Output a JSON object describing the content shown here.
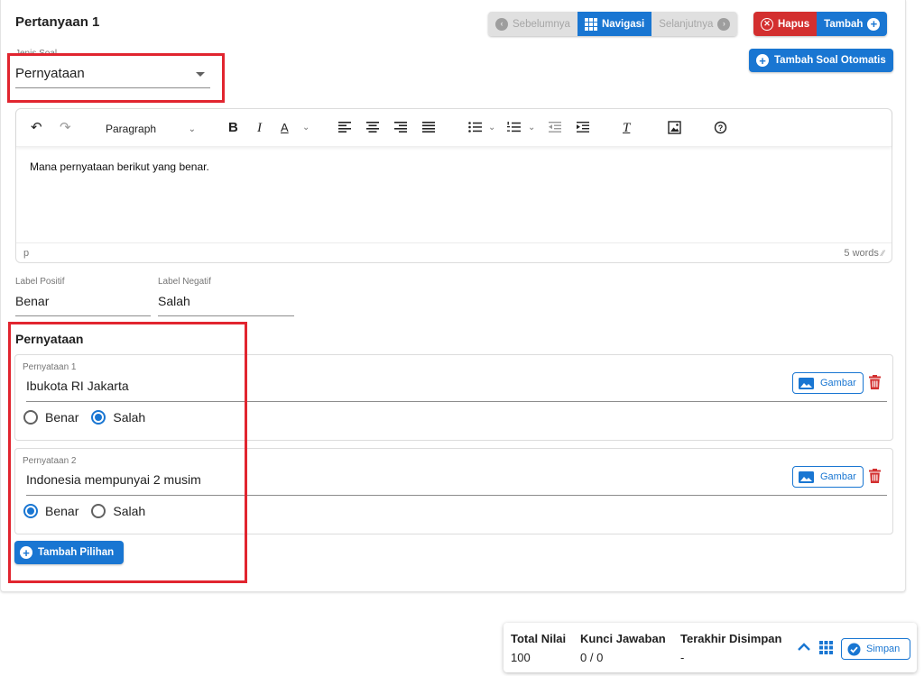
{
  "question": {
    "title": "Pertanyaan 1"
  },
  "nav": {
    "prev": "Sebelumnya",
    "navigate": "Navigasi",
    "next": "Selanjutnya"
  },
  "actions": {
    "delete": "Hapus",
    "add": "Tambah",
    "auto_add": "Tambah Soal Otomatis"
  },
  "question_type": {
    "label": "Jenis Soal",
    "value": "Pernyataan"
  },
  "editor": {
    "block_format": "Paragraph",
    "content": "Mana pernyataan berikut yang benar.",
    "path": "p",
    "word_count": "5 words"
  },
  "labels": {
    "positive_label": "Label Positif",
    "positive_value": "Benar",
    "negative_label": "Label Negatif",
    "negative_value": "Salah"
  },
  "statements": {
    "title": "Pernyataan",
    "items": [
      {
        "label": "Pernyataan 1",
        "value": "Ibukota RI Jakarta",
        "true_label": "Benar",
        "false_label": "Salah",
        "selected": "Salah",
        "image_button": "Gambar"
      },
      {
        "label": "Pernyataan 2",
        "value": "Indonesia mempunyai 2 musim",
        "true_label": "Benar",
        "false_label": "Salah",
        "selected": "Benar",
        "image_button": "Gambar"
      }
    ],
    "add_option": "Tambah Pilihan"
  },
  "summary": {
    "total_label": "Total Nilai",
    "total_value": "100",
    "key_label": "Kunci Jawaban",
    "key_value": "0 / 0",
    "saved_label": "Terakhir Disimpan",
    "saved_value": "-",
    "save_button": "Simpan"
  },
  "colors": {
    "primary": "#1976d2",
    "danger": "#d32f2f",
    "highlight": "#e1252f"
  }
}
